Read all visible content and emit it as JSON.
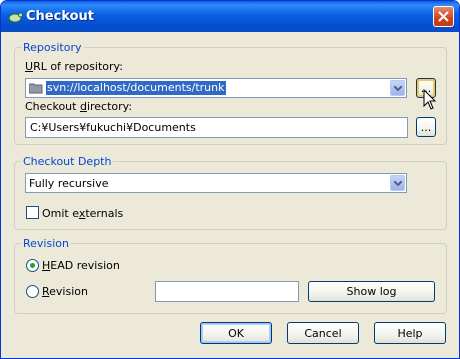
{
  "window": {
    "title": "Checkout",
    "close_label": "close"
  },
  "repository": {
    "legend": "Repository",
    "url_label": "URL of repository:",
    "url_value": "svn://localhost/documents/trunk",
    "browse_label": "...",
    "dir_label": "Checkout directory:",
    "dir_value": "C:¥Users¥fukuchi¥Documents",
    "dir_browse_label": "..."
  },
  "depth": {
    "legend": "Checkout Depth",
    "selected": "Fully recursive",
    "omit_label": "Omit externals",
    "omit_checked": false
  },
  "revision": {
    "legend": "Revision",
    "head_label": "HEAD revision",
    "head_selected": true,
    "rev_label": "Revision",
    "rev_value": "",
    "show_log_label": "Show log"
  },
  "buttons": {
    "ok": "OK",
    "cancel": "Cancel",
    "help": "Help"
  }
}
